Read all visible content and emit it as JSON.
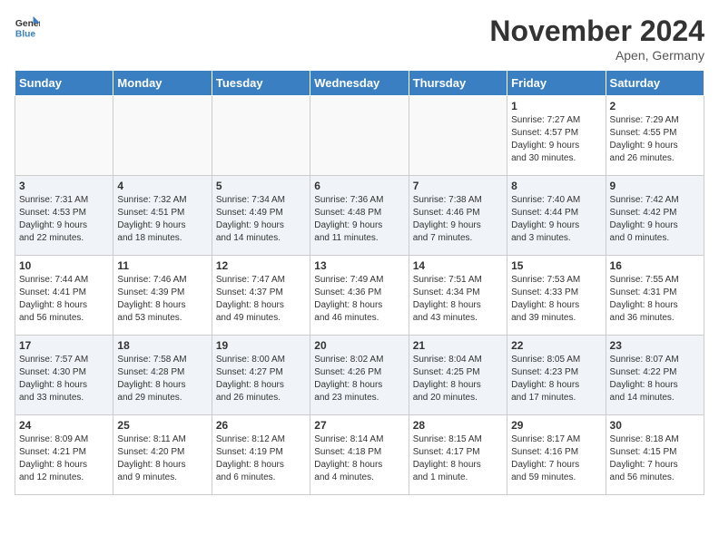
{
  "header": {
    "logo_line1": "General",
    "logo_line2": "Blue",
    "month": "November 2024",
    "location": "Apen, Germany"
  },
  "days_of_week": [
    "Sunday",
    "Monday",
    "Tuesday",
    "Wednesday",
    "Thursday",
    "Friday",
    "Saturday"
  ],
  "weeks": [
    [
      {
        "day": "",
        "info": ""
      },
      {
        "day": "",
        "info": ""
      },
      {
        "day": "",
        "info": ""
      },
      {
        "day": "",
        "info": ""
      },
      {
        "day": "",
        "info": ""
      },
      {
        "day": "1",
        "info": "Sunrise: 7:27 AM\nSunset: 4:57 PM\nDaylight: 9 hours\nand 30 minutes."
      },
      {
        "day": "2",
        "info": "Sunrise: 7:29 AM\nSunset: 4:55 PM\nDaylight: 9 hours\nand 26 minutes."
      }
    ],
    [
      {
        "day": "3",
        "info": "Sunrise: 7:31 AM\nSunset: 4:53 PM\nDaylight: 9 hours\nand 22 minutes."
      },
      {
        "day": "4",
        "info": "Sunrise: 7:32 AM\nSunset: 4:51 PM\nDaylight: 9 hours\nand 18 minutes."
      },
      {
        "day": "5",
        "info": "Sunrise: 7:34 AM\nSunset: 4:49 PM\nDaylight: 9 hours\nand 14 minutes."
      },
      {
        "day": "6",
        "info": "Sunrise: 7:36 AM\nSunset: 4:48 PM\nDaylight: 9 hours\nand 11 minutes."
      },
      {
        "day": "7",
        "info": "Sunrise: 7:38 AM\nSunset: 4:46 PM\nDaylight: 9 hours\nand 7 minutes."
      },
      {
        "day": "8",
        "info": "Sunrise: 7:40 AM\nSunset: 4:44 PM\nDaylight: 9 hours\nand 3 minutes."
      },
      {
        "day": "9",
        "info": "Sunrise: 7:42 AM\nSunset: 4:42 PM\nDaylight: 9 hours\nand 0 minutes."
      }
    ],
    [
      {
        "day": "10",
        "info": "Sunrise: 7:44 AM\nSunset: 4:41 PM\nDaylight: 8 hours\nand 56 minutes."
      },
      {
        "day": "11",
        "info": "Sunrise: 7:46 AM\nSunset: 4:39 PM\nDaylight: 8 hours\nand 53 minutes."
      },
      {
        "day": "12",
        "info": "Sunrise: 7:47 AM\nSunset: 4:37 PM\nDaylight: 8 hours\nand 49 minutes."
      },
      {
        "day": "13",
        "info": "Sunrise: 7:49 AM\nSunset: 4:36 PM\nDaylight: 8 hours\nand 46 minutes."
      },
      {
        "day": "14",
        "info": "Sunrise: 7:51 AM\nSunset: 4:34 PM\nDaylight: 8 hours\nand 43 minutes."
      },
      {
        "day": "15",
        "info": "Sunrise: 7:53 AM\nSunset: 4:33 PM\nDaylight: 8 hours\nand 39 minutes."
      },
      {
        "day": "16",
        "info": "Sunrise: 7:55 AM\nSunset: 4:31 PM\nDaylight: 8 hours\nand 36 minutes."
      }
    ],
    [
      {
        "day": "17",
        "info": "Sunrise: 7:57 AM\nSunset: 4:30 PM\nDaylight: 8 hours\nand 33 minutes."
      },
      {
        "day": "18",
        "info": "Sunrise: 7:58 AM\nSunset: 4:28 PM\nDaylight: 8 hours\nand 29 minutes."
      },
      {
        "day": "19",
        "info": "Sunrise: 8:00 AM\nSunset: 4:27 PM\nDaylight: 8 hours\nand 26 minutes."
      },
      {
        "day": "20",
        "info": "Sunrise: 8:02 AM\nSunset: 4:26 PM\nDaylight: 8 hours\nand 23 minutes."
      },
      {
        "day": "21",
        "info": "Sunrise: 8:04 AM\nSunset: 4:25 PM\nDaylight: 8 hours\nand 20 minutes."
      },
      {
        "day": "22",
        "info": "Sunrise: 8:05 AM\nSunset: 4:23 PM\nDaylight: 8 hours\nand 17 minutes."
      },
      {
        "day": "23",
        "info": "Sunrise: 8:07 AM\nSunset: 4:22 PM\nDaylight: 8 hours\nand 14 minutes."
      }
    ],
    [
      {
        "day": "24",
        "info": "Sunrise: 8:09 AM\nSunset: 4:21 PM\nDaylight: 8 hours\nand 12 minutes."
      },
      {
        "day": "25",
        "info": "Sunrise: 8:11 AM\nSunset: 4:20 PM\nDaylight: 8 hours\nand 9 minutes."
      },
      {
        "day": "26",
        "info": "Sunrise: 8:12 AM\nSunset: 4:19 PM\nDaylight: 8 hours\nand 6 minutes."
      },
      {
        "day": "27",
        "info": "Sunrise: 8:14 AM\nSunset: 4:18 PM\nDaylight: 8 hours\nand 4 minutes."
      },
      {
        "day": "28",
        "info": "Sunrise: 8:15 AM\nSunset: 4:17 PM\nDaylight: 8 hours\nand 1 minute."
      },
      {
        "day": "29",
        "info": "Sunrise: 8:17 AM\nSunset: 4:16 PM\nDaylight: 7 hours\nand 59 minutes."
      },
      {
        "day": "30",
        "info": "Sunrise: 8:18 AM\nSunset: 4:15 PM\nDaylight: 7 hours\nand 56 minutes."
      }
    ]
  ]
}
